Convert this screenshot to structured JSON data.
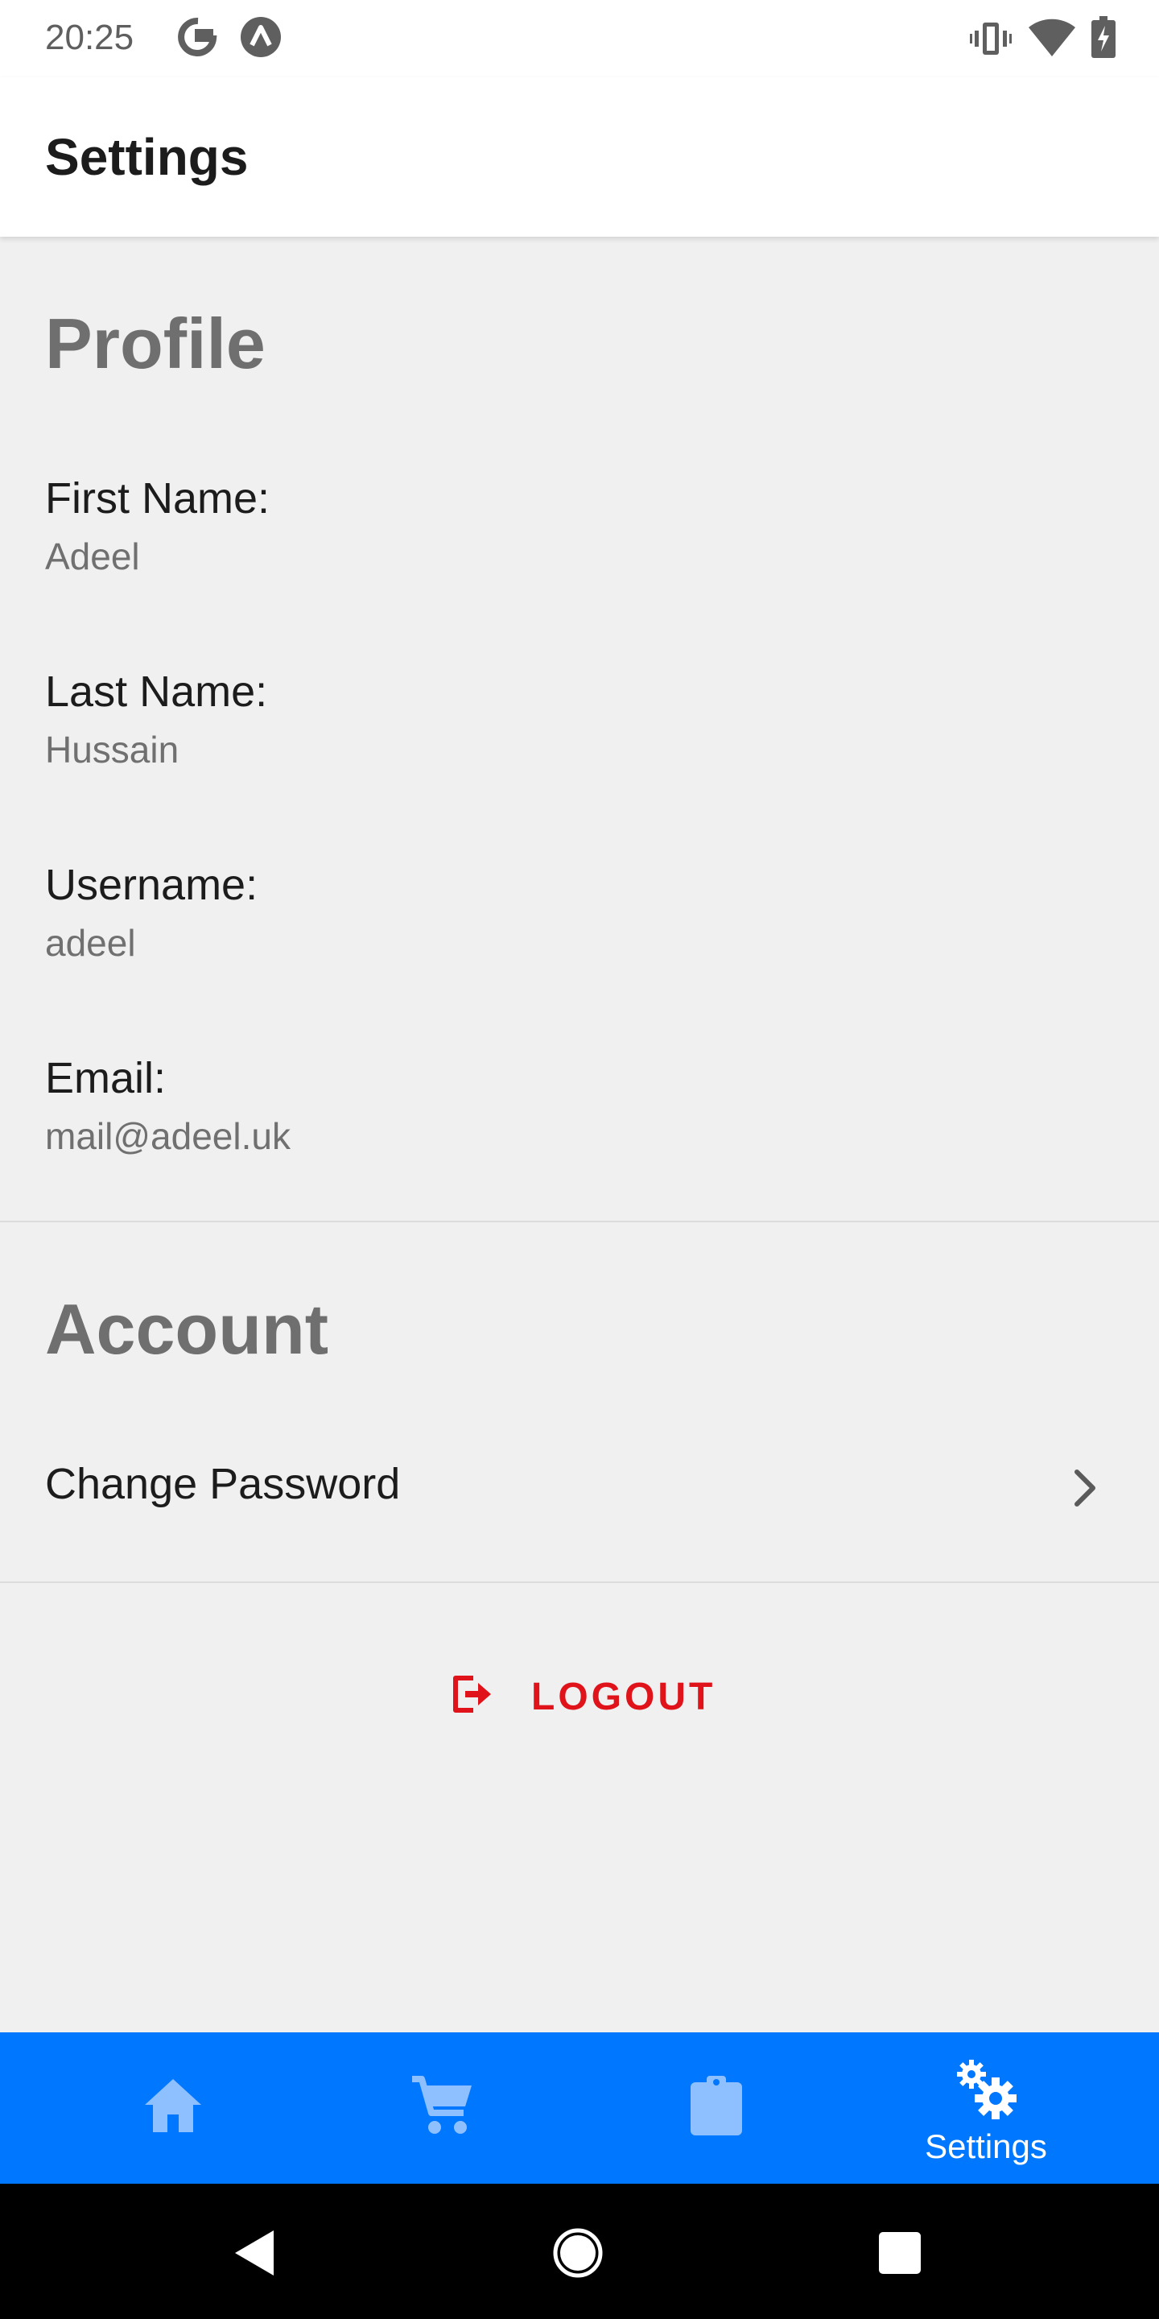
{
  "status_bar": {
    "time": "20:25",
    "icons": [
      "google-icon",
      "a-logo-icon",
      "vibrate-icon",
      "wifi-icon",
      "battery-charging-icon"
    ]
  },
  "header": {
    "title": "Settings"
  },
  "profile": {
    "section_title": "Profile",
    "fields": [
      {
        "label": "First Name:",
        "value": "Adeel"
      },
      {
        "label": "Last Name:",
        "value": "Hussain"
      },
      {
        "label": "Username:",
        "value": "adeel"
      },
      {
        "label": "Email:",
        "value": "mail@adeel.uk"
      }
    ]
  },
  "account": {
    "section_title": "Account",
    "items": [
      {
        "label": "Change Password",
        "icon": "chevron-right-icon"
      }
    ]
  },
  "logout": {
    "label": "LOGOUT",
    "icon": "logout-icon",
    "color": "#e0131a"
  },
  "tab_bar": {
    "background": "#0077ff",
    "tabs": [
      {
        "icon": "home-icon",
        "label": "",
        "active": false
      },
      {
        "icon": "cart-icon",
        "label": "",
        "active": false
      },
      {
        "icon": "clipboard-icon",
        "label": "",
        "active": false
      },
      {
        "icon": "settings-gears-icon",
        "label": "Settings",
        "active": true
      }
    ]
  },
  "nav_bar": {
    "buttons": [
      "back-icon",
      "home-circle-icon",
      "recent-apps-icon"
    ]
  }
}
